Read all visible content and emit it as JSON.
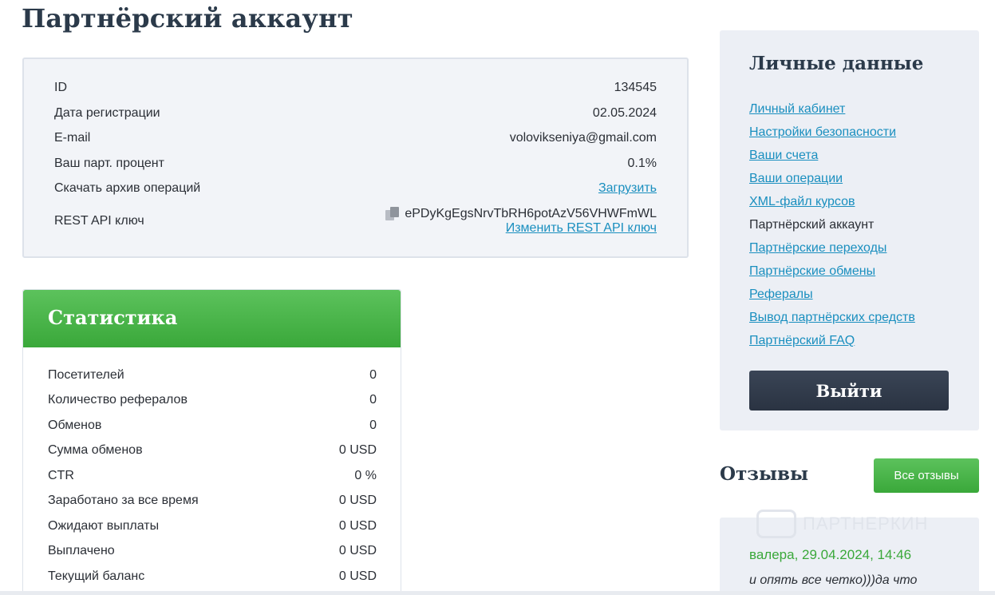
{
  "page": {
    "title": "Партнёрский аккаунт"
  },
  "account": {
    "id_label": "ID",
    "id_value": "134545",
    "reg_label": "Дата регистрации",
    "reg_value": "02.05.2024",
    "email_label": "E-mail",
    "email_value": "voloviksenіya@gmail.com",
    "percent_label": "Ваш парт. процент",
    "percent_value": "0.1%",
    "archive_label": "Скачать архив операций",
    "archive_link": "Загрузить",
    "api_label": "REST API ключ",
    "api_key": "ePDyKgEgsNrvTbRH6potAzV56VHWFmWL",
    "api_change_link": "Изменить REST API ключ",
    "copy_icon": "copy-icon"
  },
  "stats": {
    "title": "Статистика",
    "rows": [
      {
        "label": "Посетителей",
        "value": "0"
      },
      {
        "label": "Количество рефералов",
        "value": "0"
      },
      {
        "label": "Обменов",
        "value": "0"
      },
      {
        "label": "Сумма обменов",
        "value": "0 USD"
      },
      {
        "label": "CTR",
        "value": "0 %"
      },
      {
        "label": "Заработано за все время",
        "value": "0 USD"
      },
      {
        "label": "Ожидают выплаты",
        "value": "0 USD"
      },
      {
        "label": "Выплачено",
        "value": "0 USD"
      },
      {
        "label": "Текущий баланс",
        "value": "0 USD"
      }
    ]
  },
  "sidebar": {
    "title": "Личные данные",
    "items": [
      {
        "label": "Личный кабинет",
        "active": false
      },
      {
        "label": "Настройки безопасности",
        "active": false
      },
      {
        "label": "Ваши счета",
        "active": false
      },
      {
        "label": "Ваши операции",
        "active": false
      },
      {
        "label": "XML-файл курсов",
        "active": false
      },
      {
        "label": "Партнёрский аккаунт",
        "active": true
      },
      {
        "label": "Партнёрские переходы",
        "active": false
      },
      {
        "label": "Партнёрские обмены",
        "active": false
      },
      {
        "label": "Рефералы",
        "active": false
      },
      {
        "label": "Вывод партнёрских средств",
        "active": false
      },
      {
        "label": "Партнёрский FAQ",
        "active": false
      }
    ],
    "logout_label": "Выйти"
  },
  "reviews": {
    "title": "Отзывы",
    "all_button": "Все отзывы",
    "watermark": "ПАРТНЕРКИН",
    "author": "валера, 29.04.2024, 14:46",
    "text": "и опять все четко)))да что"
  },
  "colors": {
    "accent_green": "#3aa83a",
    "link_blue": "#1a8fbf",
    "dark_button": "#2a3342"
  }
}
